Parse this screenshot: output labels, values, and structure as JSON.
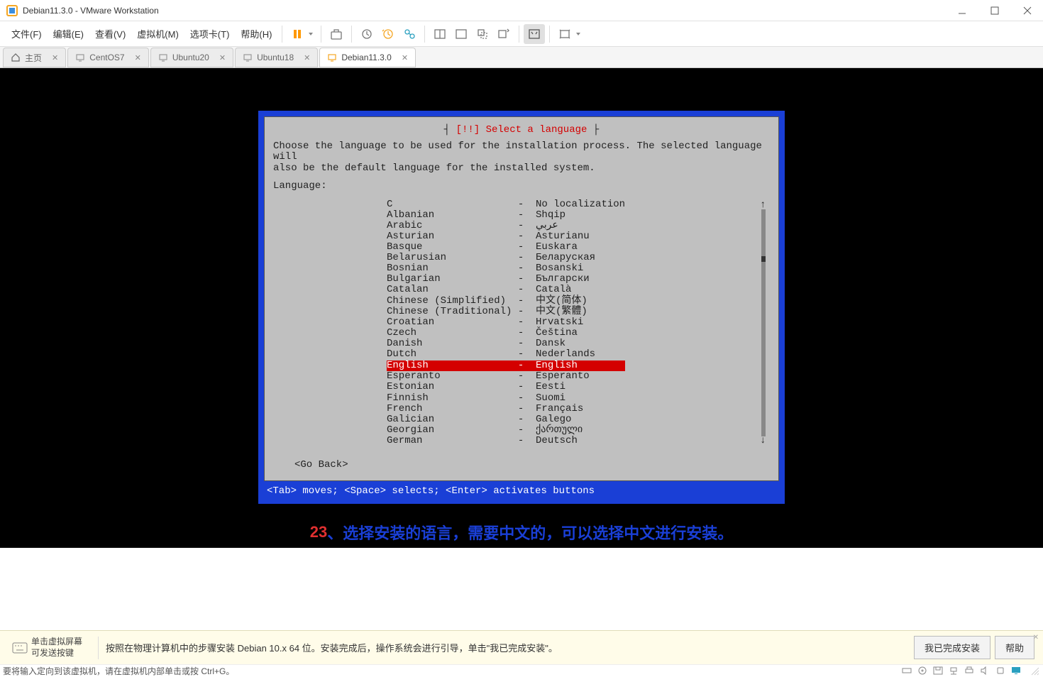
{
  "window": {
    "title": "Debian11.3.0 - VMware Workstation"
  },
  "menu": {
    "file": "文件(F)",
    "edit": "编辑(E)",
    "view": "查看(V)",
    "vm": "虚拟机(M)",
    "tabs": "选项卡(T)",
    "help": "帮助(H)"
  },
  "tabs": {
    "home": "主页",
    "items": [
      {
        "label": "CentOS7"
      },
      {
        "label": "Ubuntu20"
      },
      {
        "label": "Ubuntu18"
      },
      {
        "label": "Debian11.3.0",
        "active": true
      }
    ]
  },
  "installer": {
    "heading": "[!!] Select a language",
    "intro": "Choose the language to be used for the installation process. The selected language will\nalso be the default language for the installed system.",
    "label": "Language:",
    "go_back": "<Go Back>",
    "footer": "<Tab> moves; <Space> selects; <Enter> activates buttons",
    "languages": [
      {
        "en": "C",
        "sep": "-",
        "native": "No localization"
      },
      {
        "en": "Albanian",
        "sep": "-",
        "native": "Shqip"
      },
      {
        "en": "Arabic",
        "sep": "-",
        "native": "عربي"
      },
      {
        "en": "Asturian",
        "sep": "-",
        "native": "Asturianu"
      },
      {
        "en": "Basque",
        "sep": "-",
        "native": "Euskara"
      },
      {
        "en": "Belarusian",
        "sep": "-",
        "native": "Беларуская"
      },
      {
        "en": "Bosnian",
        "sep": "-",
        "native": "Bosanski"
      },
      {
        "en": "Bulgarian",
        "sep": "-",
        "native": "Български"
      },
      {
        "en": "Catalan",
        "sep": "-",
        "native": "Català"
      },
      {
        "en": "Chinese (Simplified)",
        "sep": "-",
        "native": "中文(简体)"
      },
      {
        "en": "Chinese (Traditional)",
        "sep": "-",
        "native": "中文(繁體)"
      },
      {
        "en": "Croatian",
        "sep": "-",
        "native": "Hrvatski"
      },
      {
        "en": "Czech",
        "sep": "-",
        "native": "Čeština"
      },
      {
        "en": "Danish",
        "sep": "-",
        "native": "Dansk"
      },
      {
        "en": "Dutch",
        "sep": "-",
        "native": "Nederlands"
      },
      {
        "en": "English",
        "sep": "-",
        "native": "English",
        "selected": true
      },
      {
        "en": "Esperanto",
        "sep": "-",
        "native": "Esperanto"
      },
      {
        "en": "Estonian",
        "sep": "-",
        "native": "Eesti"
      },
      {
        "en": "Finnish",
        "sep": "-",
        "native": "Suomi"
      },
      {
        "en": "French",
        "sep": "-",
        "native": "Français"
      },
      {
        "en": "Galician",
        "sep": "-",
        "native": "Galego"
      },
      {
        "en": "Georgian",
        "sep": "-",
        "native": "ქართული"
      },
      {
        "en": "German",
        "sep": "-",
        "native": "Deutsch"
      }
    ]
  },
  "caption": {
    "num": "23",
    "text": "、选择安装的语言，需要中文的，可以选择中文进行安装。"
  },
  "infobar": {
    "hint1": "单击虚拟屏幕",
    "hint2": "可发送按键",
    "msg": "按照在物理计算机中的步骤安装 Debian 10.x 64 位。安装完成后，操作系统会进行引导，单击\"我已完成安装\"。",
    "done": "我已完成安装",
    "help": "帮助"
  },
  "statusbar": {
    "msg": "要将输入定向到该虚拟机，请在虚拟机内部单击或按 Ctrl+G。"
  }
}
